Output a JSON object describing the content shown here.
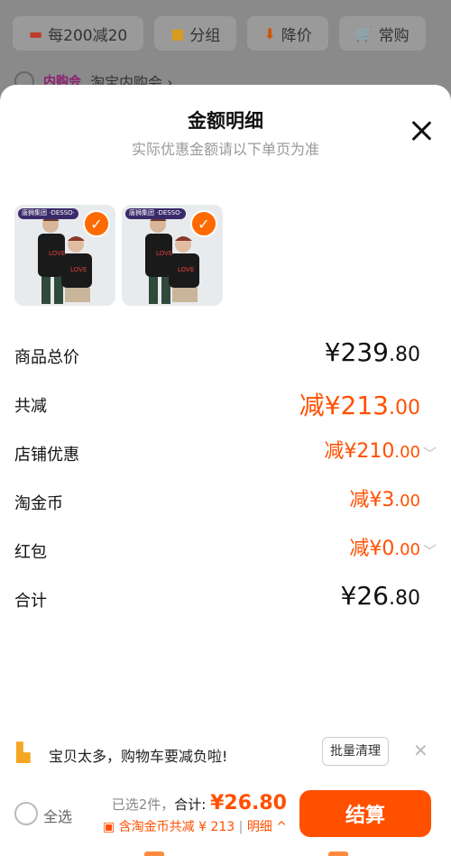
{
  "background": {
    "filters": [
      {
        "icon": "tag-icon",
        "label": "每200减20"
      },
      {
        "icon": "folder-icon",
        "label": "分组"
      },
      {
        "icon": "arrow-down-icon",
        "label": "降价"
      },
      {
        "icon": "cart-icon",
        "label": "常购"
      }
    ],
    "store_tag": "内购会",
    "store_name": "淘宝内购会 ›"
  },
  "sheet": {
    "title": "金额明细",
    "subtitle": "实际优惠金额请以下单页为准",
    "thumbnails": [
      {
        "brand": "唐狮集团 ·DESSO·"
      },
      {
        "brand": "唐狮集团 ·DESSO·"
      }
    ],
    "rows": [
      {
        "label": "商品总价",
        "value_main": "¥239",
        "value_dec": ".80"
      },
      {
        "label": "共减",
        "value_main": "减¥213",
        "value_dec": ".00"
      },
      {
        "label": "店铺优惠",
        "value_main": "减¥210",
        "value_dec": ".00"
      },
      {
        "label": "淘金币",
        "value_main": "减¥3",
        "value_dec": ".00"
      },
      {
        "label": "红包",
        "value_main": "减¥0",
        "value_dec": ".00"
      },
      {
        "label": "合计",
        "value_main": "¥26",
        "value_dec": ".80"
      }
    ]
  },
  "notice": {
    "text": "宝贝太多，购物车要减负啦!",
    "clear_button": "批量清理"
  },
  "footer": {
    "select_all": "全选",
    "selected": "已选2件，",
    "total_label": "合计:",
    "total_value": "¥26.80",
    "deduction": "含淘金币共减 ¥ 213",
    "detail_link": "明细 ^",
    "checkout": "结算"
  },
  "colors": {
    "accent": "#ff5000",
    "check": "#ff6a00"
  }
}
